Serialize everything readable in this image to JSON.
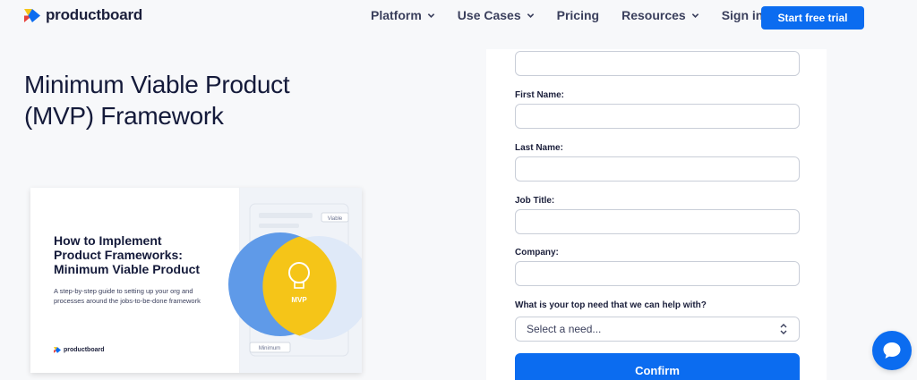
{
  "brand": {
    "name": "productboard",
    "colors": {
      "blue": "#0b6cf0",
      "yellow": "#f5c518",
      "red": "#e8413c",
      "navy": "#141a3a"
    }
  },
  "nav": {
    "items": [
      {
        "label": "Platform",
        "has_dropdown": true
      },
      {
        "label": "Use Cases",
        "has_dropdown": true
      },
      {
        "label": "Pricing",
        "has_dropdown": false
      },
      {
        "label": "Resources",
        "has_dropdown": true
      },
      {
        "label": "Sign in",
        "has_dropdown": false
      }
    ],
    "cta": "Start free trial"
  },
  "hero": {
    "title_line1": "Minimum Viable Product",
    "title_line2": "(MVP) Framework"
  },
  "cover": {
    "title_line1": "How to Implement",
    "title_line2": "Product Frameworks:",
    "title_line3": "Minimum Viable Product",
    "subtitle_line1": "A step-by-step guide to setting up your org and",
    "subtitle_line2": "processes around the jobs-to-be-done framework",
    "logo_text": "productboard",
    "venn_label": "MVP",
    "tag_top": "Viable",
    "tag_bottom": "Minimum"
  },
  "form": {
    "fields": [
      {
        "label": "First Name:",
        "value": ""
      },
      {
        "label": "Last Name:",
        "value": ""
      },
      {
        "label": "Job Title:",
        "value": ""
      },
      {
        "label": "Company:",
        "value": ""
      }
    ],
    "need_label": "What is your top need that we can help with?",
    "need_placeholder": "Select a need...",
    "confirm_label": "Confirm"
  },
  "chat": {
    "icon": "chat-bubble-icon"
  }
}
